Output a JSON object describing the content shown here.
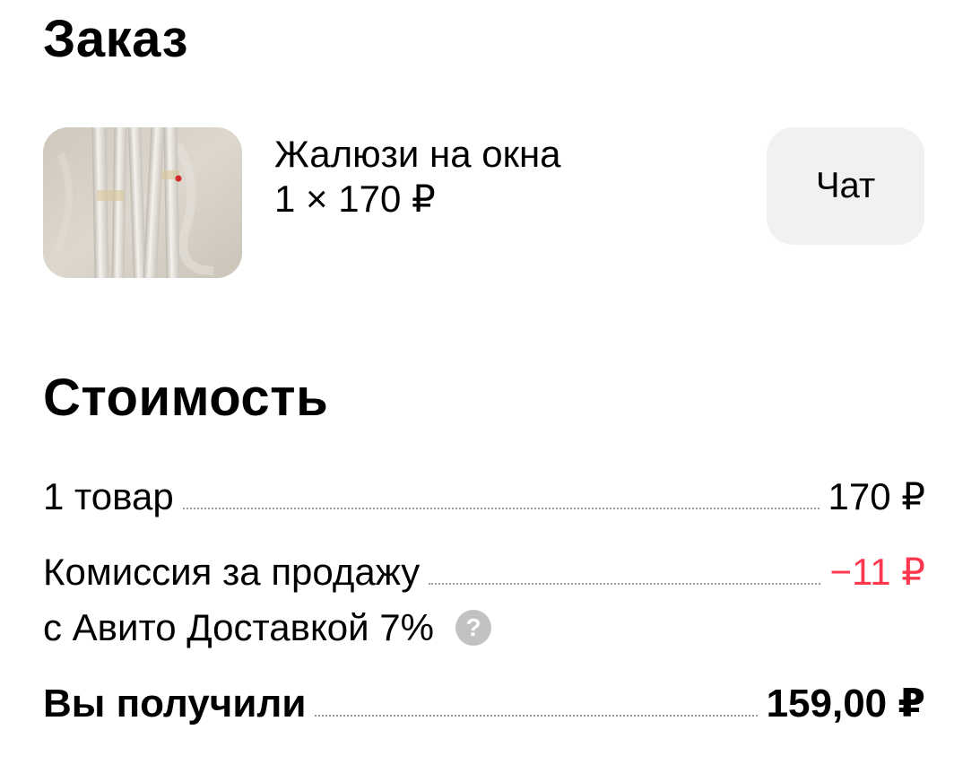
{
  "order": {
    "title": "Заказ",
    "product": {
      "name": "Жалюзи на окна",
      "quantity_price": "1 × 170 ₽",
      "image_icon": "product-photo"
    },
    "chat_label": "Чат"
  },
  "cost": {
    "title": "Стоимость",
    "items_label": "1 товар",
    "items_value": "170 ₽",
    "fee_label_line1": "Комиссия за продажу",
    "fee_label_line2": "с Авито Доставкой 7%",
    "fee_value": "−11 ₽",
    "help_icon": "?",
    "total_label": "Вы получили",
    "total_value": "159,00 ₽"
  },
  "colors": {
    "fee_negative": "#ff3850",
    "chat_button_bg": "#f2f1f0",
    "help_icon_bg": "#c2c2c2"
  }
}
